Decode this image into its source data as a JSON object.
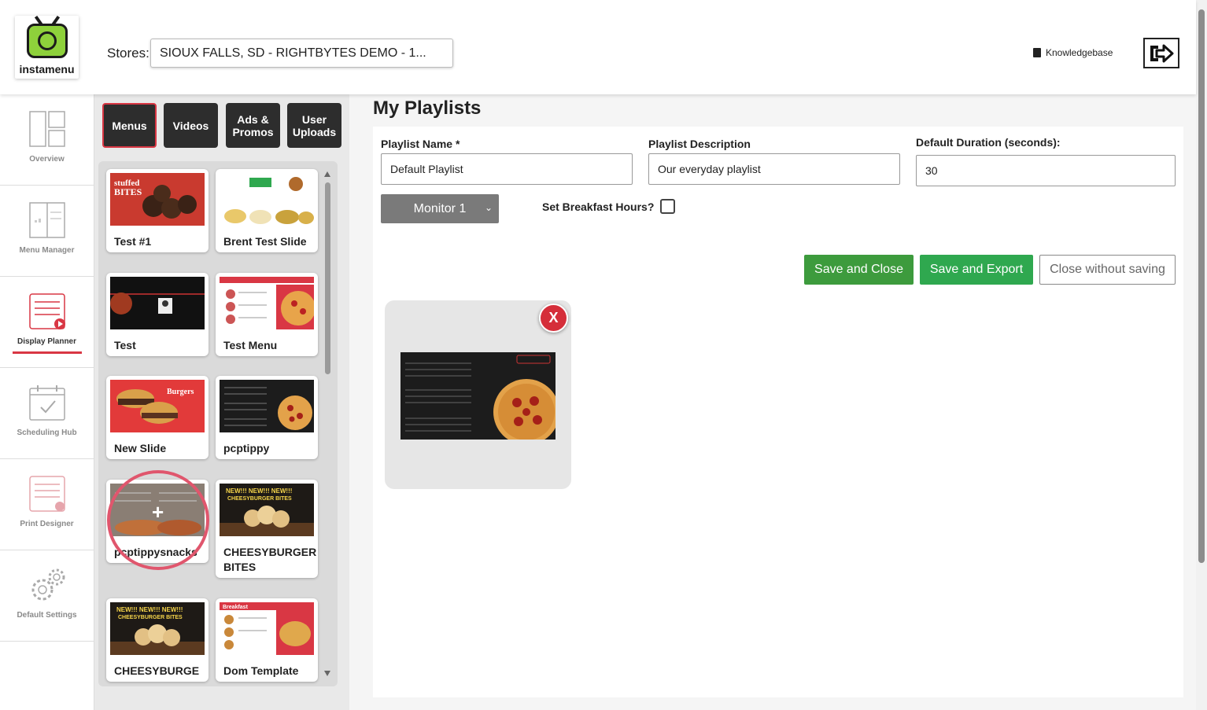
{
  "app": {
    "logo_text": "instamenu"
  },
  "header": {
    "stores_label": "Stores:",
    "stores_value": "SIOUX FALLS, SD - RIGHTBYTES DEMO - 1...",
    "knowledgebase": "Knowledgebase"
  },
  "sidebar": {
    "items": [
      {
        "label": "Overview",
        "icon": "layout-icon"
      },
      {
        "label": "Menu Manager",
        "icon": "menu-board-icon"
      },
      {
        "label": "Display Planner",
        "icon": "display-planner-icon",
        "active": true
      },
      {
        "label": "Scheduling Hub",
        "icon": "calendar-check-icon"
      },
      {
        "label": "Print Designer",
        "icon": "print-icon"
      },
      {
        "label": "Default Settings",
        "icon": "gears-icon"
      }
    ]
  },
  "library": {
    "tabs": [
      "Menus",
      "Videos",
      "Ads & Promos",
      "User Uploads"
    ],
    "active_tab": "Menus",
    "cards": [
      {
        "name": "Test #1"
      },
      {
        "name": "Brent Test Slide"
      },
      {
        "name": "Test"
      },
      {
        "name": "Test Menu"
      },
      {
        "name": "New Slide"
      },
      {
        "name": "pcptippy"
      },
      {
        "name": "pcptippysnacks"
      },
      {
        "name": "CHEESYBURGER BITES"
      },
      {
        "name": "CHEESYBURGE"
      },
      {
        "name": "Dom Template"
      }
    ]
  },
  "main": {
    "title": "My Playlists",
    "fields": {
      "name_label": "Playlist Name *",
      "name_value": "Default Playlist",
      "desc_label": "Playlist Description",
      "desc_value": "Our everyday playlist",
      "duration_label": "Default Duration (seconds):",
      "duration_value": "30"
    },
    "monitor_value": "Monitor 1",
    "breakfast_label": "Set Breakfast Hours?",
    "buttons": {
      "save_close": "Save and Close",
      "save_export": "Save and Export",
      "close_no_save": "Close without saving"
    },
    "playlist_item_close": "X"
  },
  "colors": {
    "accent_red": "#d93744",
    "save_green": "#3d9b3d",
    "export_green": "#2fa84f",
    "monitor_gray": "#7a7a7a"
  }
}
